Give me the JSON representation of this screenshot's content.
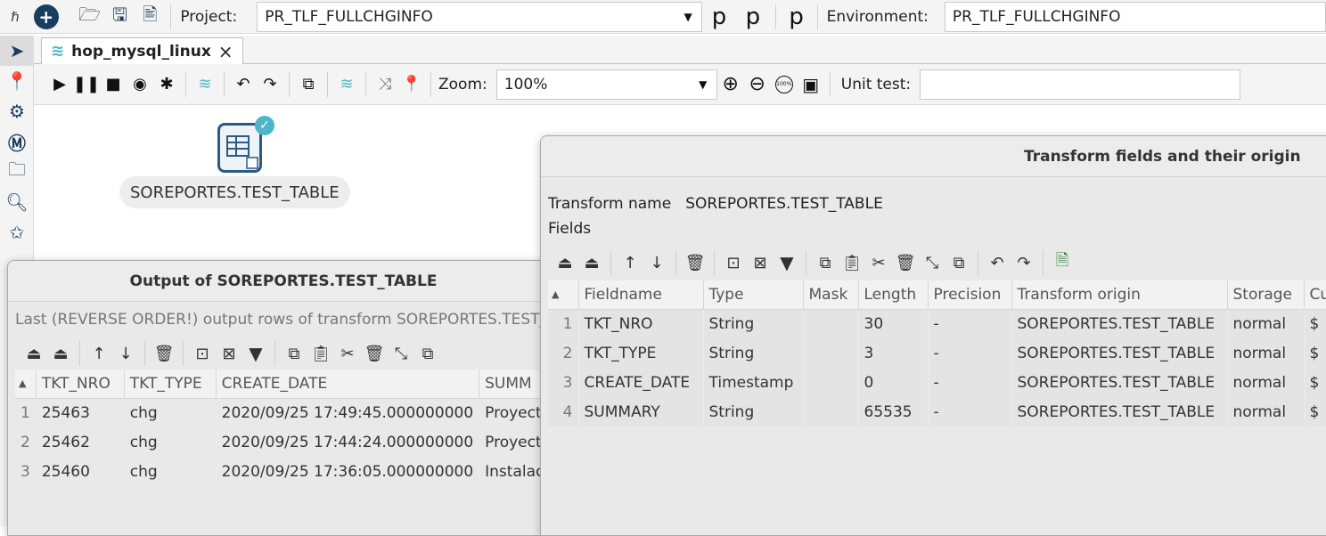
{
  "toolbar": {
    "project_label": "Project:",
    "project_value": "PR_TLF_FULLCHGINFO",
    "environment_label": "Environment:",
    "environment_value": "PR_TLF_FULLCHGINFO"
  },
  "tab": {
    "title": "hop_mysql_linux",
    "close": "×"
  },
  "pipeline_toolbar": {
    "zoom_label": "Zoom:",
    "zoom_value": "100%",
    "unit_test_label": "Unit test:",
    "unit_test_value": "",
    "zoom_100_badge": "100%"
  },
  "canvas": {
    "transform_label": "SOREPORTES.TEST_TABLE"
  },
  "output_dialog": {
    "title": "Output of SOREPORTES.TEST_TABLE",
    "subtitle": "Last (REVERSE ORDER!) output rows of transform SOREPORTES.TEST_TA",
    "columns": [
      "TKT_NRO",
      "TKT_TYPE",
      "CREATE_DATE",
      "SUMM"
    ],
    "rows": [
      {
        "n": "1",
        "nro": "25463",
        "type": "chg",
        "date": "2020/09/25 17:49:45.000000000",
        "summary": "Proyect"
      },
      {
        "n": "2",
        "nro": "25462",
        "type": "chg",
        "date": "2020/09/25 17:44:24.000000000",
        "summary": "Proyect"
      },
      {
        "n": "3",
        "nro": "25460",
        "type": "chg",
        "date": "2020/09/25 17:36:05.000000000",
        "summary": "Instalac"
      }
    ]
  },
  "fields_dialog": {
    "title": "Transform fields and their origin",
    "transform_name_label": "Transform name",
    "transform_name_value": "SOREPORTES.TEST_TABLE",
    "fields_label": "Fields",
    "columns": [
      "Fieldname",
      "Type",
      "Mask",
      "Length",
      "Precision",
      "Transform origin",
      "Storage",
      "Cu"
    ],
    "rows": [
      {
        "n": "1",
        "name": "TKT_NRO",
        "type": "String",
        "mask": "",
        "length": "30",
        "precision": "-",
        "origin": "SOREPORTES.TEST_TABLE",
        "storage": "normal",
        "cu": "$"
      },
      {
        "n": "2",
        "name": "TKT_TYPE",
        "type": "String",
        "mask": "",
        "length": "3",
        "precision": "-",
        "origin": "SOREPORTES.TEST_TABLE",
        "storage": "normal",
        "cu": "$"
      },
      {
        "n": "3",
        "name": "CREATE_DATE",
        "type": "Timestamp",
        "mask": "",
        "length": "0",
        "precision": "-",
        "origin": "SOREPORTES.TEST_TABLE",
        "storage": "normal",
        "cu": "$"
      },
      {
        "n": "4",
        "name": "SUMMARY",
        "type": "String",
        "mask": "",
        "length": "65535",
        "precision": "-",
        "origin": "SOREPORTES.TEST_TABLE",
        "storage": "normal",
        "cu": "$"
      }
    ]
  },
  "colors": {
    "accent": "#1a3c5e",
    "teal": "#4db6c9",
    "delete_red": "#d32f2f"
  }
}
